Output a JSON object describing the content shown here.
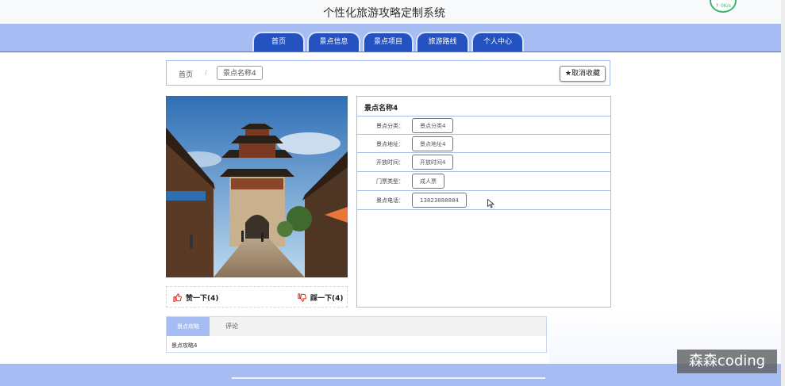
{
  "app": {
    "title": "个性化旅游攻略定制系统"
  },
  "nav": {
    "tabs": [
      "首页",
      "景点信息",
      "景点项目",
      "旅游路线",
      "个人中心"
    ]
  },
  "breadcrumb": {
    "home": "首页",
    "separator": "/",
    "current": "景点名称4"
  },
  "actions": {
    "unfavorite": "取消收藏"
  },
  "detail": {
    "name": "景点名称4",
    "fields": [
      {
        "label": "景点分类：",
        "value": "景点分类4"
      },
      {
        "label": "景点地址：",
        "value": "景点地址4"
      },
      {
        "label": "开放时间：",
        "value": "开放时间4"
      },
      {
        "label": "门票类型：",
        "value": "成人票"
      },
      {
        "label": "景点电话：",
        "value": "13823888884"
      }
    ]
  },
  "votes": {
    "like": "赞一下(4)",
    "dislike": "踩一下(4)"
  },
  "bottom_tabs": {
    "active": "景点攻略",
    "other": "评论",
    "content": "景点攻略4"
  },
  "watermark": "森森coding",
  "badge": "↑ 0K/s",
  "colors": {
    "nav_bg": "#a6bdf3",
    "tab_bg": "#2452c1",
    "border": "#a8bfe9"
  }
}
